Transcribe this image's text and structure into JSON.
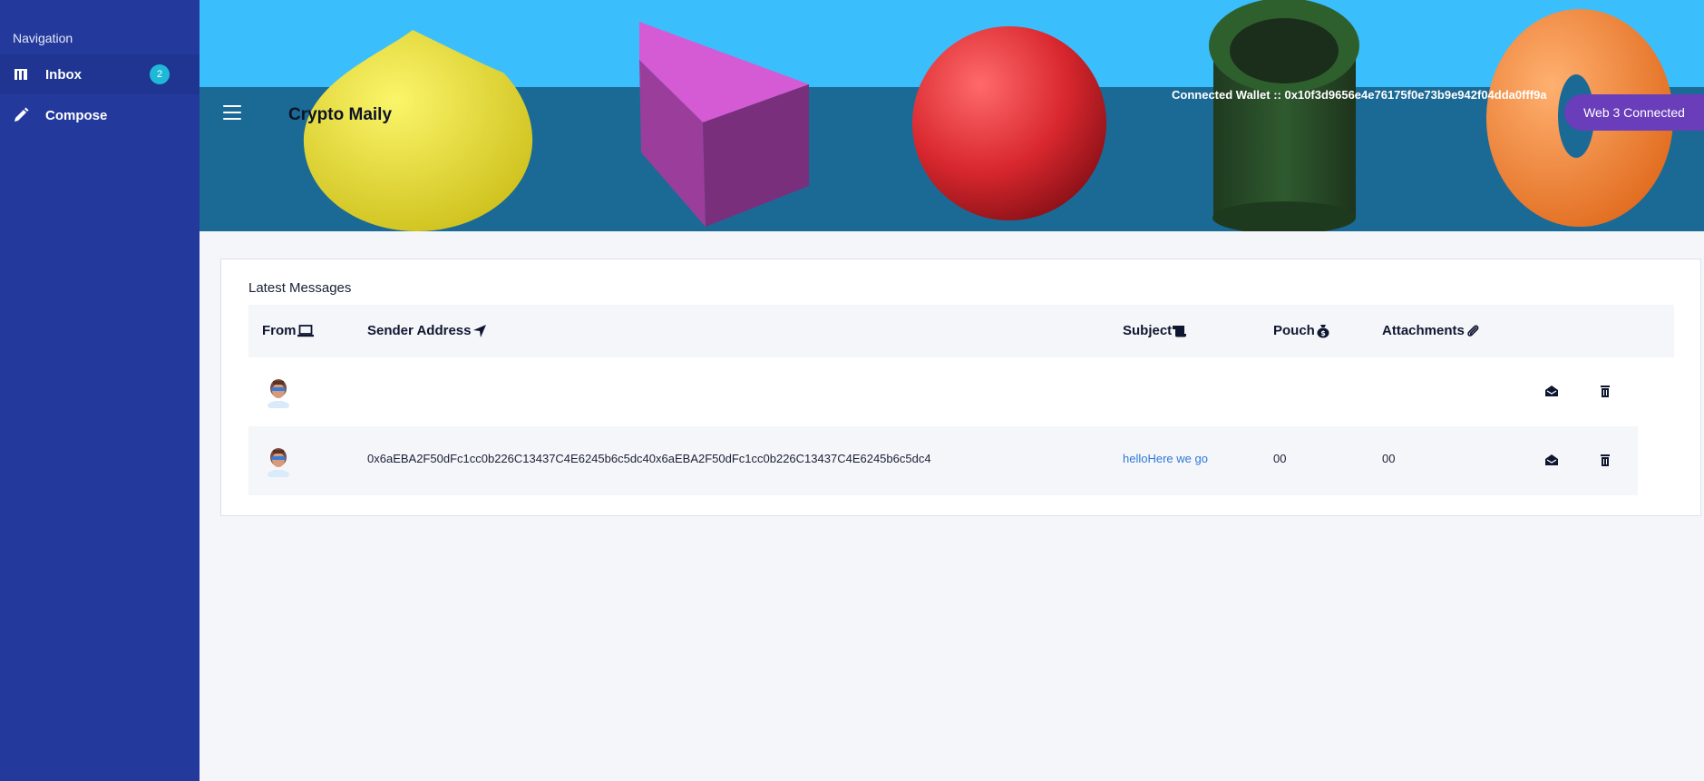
{
  "sidebar": {
    "title": "Navigation",
    "items": [
      {
        "label": "Inbox",
        "icon": "inbox-icon",
        "badge": "2"
      },
      {
        "label": "Compose",
        "icon": "pencil-icon"
      }
    ]
  },
  "header": {
    "app_title": "Crypto Maily",
    "wallet_text": "Connected Wallet :: 0x10f3d9656e4e76175f0e73b9e942f04dda0fff9a",
    "web3_button": "Web 3 Connected"
  },
  "messages": {
    "title": "Latest Messages",
    "columns": {
      "from": "From",
      "sender": "Sender Address",
      "subject": "Subject",
      "pouch": "Pouch",
      "attachments": "Attachments"
    },
    "rows": [
      {
        "sender": "",
        "subject": "",
        "pouch": "",
        "attachments": ""
      },
      {
        "sender": "0x6aEBA2F50dFc1cc0b226C13437C4E6245b6c5dc40x6aEBA2F50dFc1cc0b226C13437C4E6245b6c5dc4",
        "subject": "helloHere we go",
        "pouch": "00",
        "attachments": "00"
      }
    ]
  },
  "colors": {
    "sidebar": "#233a9c",
    "sky": "#3bbefc",
    "sea": "#1b6a96",
    "button": "#6a3dbb",
    "badge": "#1fb8d8",
    "link": "#2f78d6"
  }
}
